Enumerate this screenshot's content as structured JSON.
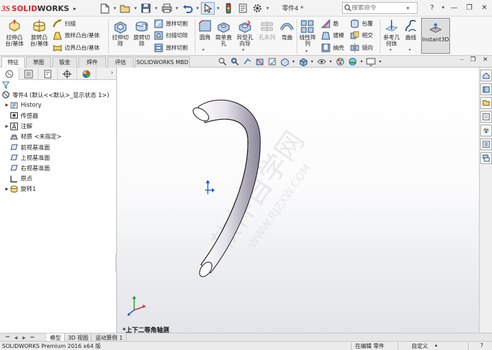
{
  "app": {
    "brand_prefix": "3S",
    "brand_name": "SOLID",
    "brand_suffix": "WORKS",
    "document_title": "零件4 *"
  },
  "search": {
    "placeholder": "搜索命令"
  },
  "ribbon": {
    "features": [
      {
        "label": "拉伸凸\n台/基体",
        "icon": "extrude-boss-icon"
      },
      {
        "label": "旋转凸\n台/基体",
        "icon": "revolve-boss-icon"
      }
    ],
    "boss_small": [
      "扫描",
      "放样凸台/基体",
      "边界凸台/基体"
    ],
    "cuts": [
      {
        "label": "拉伸切\n除",
        "icon": "extrude-cut-icon"
      },
      {
        "label": "旋转切\n除",
        "icon": "revolve-cut-icon"
      }
    ],
    "cut_small": [
      "放样切割",
      "扫描切除",
      "放样切割"
    ],
    "tools": [
      {
        "label": "圆角",
        "icon": "fillet-icon",
        "disabled": false
      },
      {
        "label": "简单直\n孔",
        "icon": "simple-hole-icon",
        "disabled": false
      },
      {
        "label": "异型孔\n向导",
        "icon": "hole-wizard-icon",
        "disabled": false
      },
      {
        "label": "孔系列",
        "icon": "hole-series-icon",
        "disabled": true
      },
      {
        "label": "弯曲",
        "icon": "flex-icon",
        "disabled": false
      }
    ],
    "pattern": {
      "label": "线性阵\n列"
    },
    "pattern_small": [
      "筋",
      "拔模",
      "抽壳"
    ],
    "wrap_small": [
      "包覆",
      "相交",
      "镜向"
    ],
    "refgeom": {
      "label": "参考几\n何体"
    },
    "curves": {
      "label": "曲线"
    },
    "instant3d": {
      "label": "Instant3D"
    }
  },
  "command_tabs": [
    "特征",
    "草图",
    "钣金",
    "焊件",
    "评估",
    "SOLIDWORKS MBD"
  ],
  "tree": {
    "root": "零件4 (默认<<默认>_显示状态 1>)",
    "items": [
      {
        "label": "History",
        "expandable": true,
        "icon": "history-icon"
      },
      {
        "label": "传感器",
        "expandable": false,
        "icon": "sensor-icon"
      },
      {
        "label": "注解",
        "expandable": true,
        "icon": "annotation-icon"
      },
      {
        "label": "材质 <未指定>",
        "expandable": false,
        "icon": "material-icon"
      },
      {
        "label": "前视基准面",
        "expandable": false,
        "icon": "plane-icon"
      },
      {
        "label": "上视基准面",
        "expandable": false,
        "icon": "plane-icon"
      },
      {
        "label": "右视基准面",
        "expandable": false,
        "icon": "plane-icon"
      },
      {
        "label": "原点",
        "expandable": false,
        "icon": "origin-icon"
      },
      {
        "label": "旋转1",
        "expandable": true,
        "icon": "revolve-feature-icon"
      }
    ]
  },
  "viewport": {
    "view_label": "*上下二等角轴测",
    "watermark_lines": [
      "软件自学网",
      "WWW.RJZXW.COM"
    ]
  },
  "bottom_tabs": [
    "模型",
    "3D 视图",
    "运动算例 1"
  ],
  "status": {
    "product": "SOLIDWORKS Premium 2016 x64 版",
    "edit_state": "在编辑 零件",
    "units": "自定义"
  },
  "colors": {
    "brand_red": "#d42a2a",
    "accent_blue": "#1f6fc9"
  }
}
